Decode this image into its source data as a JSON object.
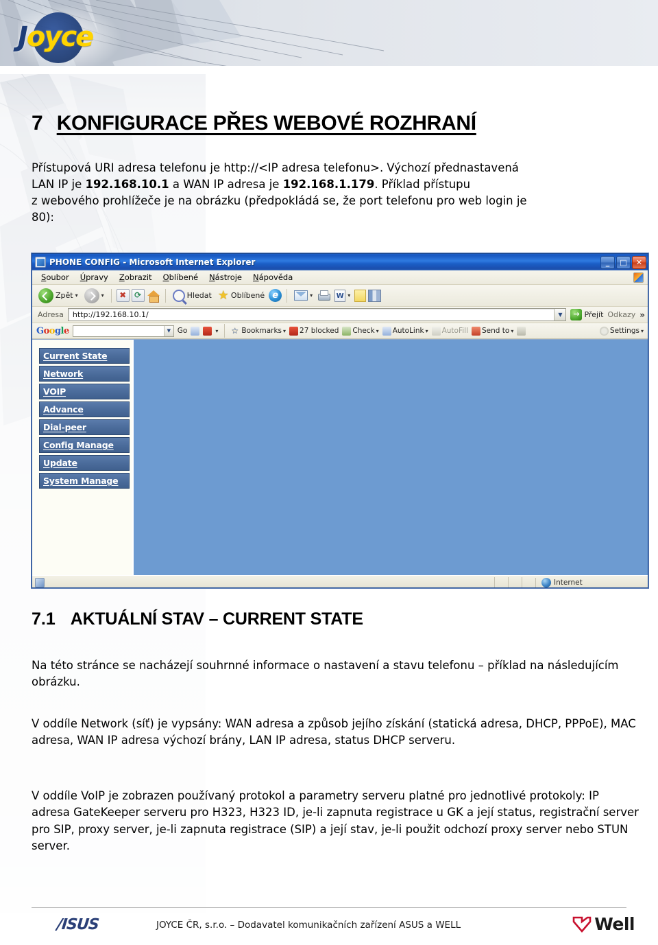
{
  "document": {
    "heading_number": "7",
    "heading_title": "KONFIGURACE PŘES WEBOVÉ ROZHRANÍ",
    "intro_line1": "Přístupová URI adresa telefonu je http://<IP adresa telefonu>. Výchozí přednastavená",
    "intro_line2_a": "LAN IP je ",
    "intro_lan_ip": "192.168.10.1",
    "intro_line2_b": " a WAN IP adresa je ",
    "intro_wan_ip": "192.168.1.179",
    "intro_line2_c": ". Příklad přístupu",
    "intro_line3": "z webového prohlížeče je na obrázku (předpokládá se, že port telefonu pro web login je",
    "intro_line4": "80):",
    "section_number": "7.1",
    "section_title": "AKTUÁLNÍ STAV – CURRENT STATE",
    "paragraph_1": "Na této stránce se nacházejí souhrnné informace o nastavení a stavu telefonu – příklad na následujícím obrázku.",
    "paragraph_2": "V oddíle Network (síť) je vypsány: WAN adresa a způsob jejího získání (statická adresa, DHCP, PPPoE), MAC adresa, WAN IP adresa výchozí brány, LAN IP adresa, status DHCP serveru.",
    "paragraph_3": "V oddíle VoIP je zobrazen používaný protokol a parametry serveru platné pro jednotlivé protokoly:  IP adresa GateKeeper serveru pro H323, H323 ID, je-li zapnuta registrace u GK a její status, registrační server pro SIP, proxy server, je-li zapnuta registrace (SIP) a její stav, je-li použit odchozí proxy server nebo STUN server."
  },
  "brand": {
    "logo_j": "J",
    "logo_rest": "oyce",
    "accent_blue": "#1d3c77",
    "accent_yellow": "#ffd400"
  },
  "browser": {
    "title": "PHONE CONFIG - Microsoft Internet Explorer",
    "window_buttons": {
      "minimize": "_",
      "maximize": "□",
      "close": "✕"
    },
    "menu": [
      {
        "pre": "S",
        "post": "oubor"
      },
      {
        "pre": "Ú",
        "post": "pravy"
      },
      {
        "pre": "Z",
        "post": "obrazit"
      },
      {
        "pre": "O",
        "post": "blíbené"
      },
      {
        "pre": "N",
        "post": "ástroje"
      },
      {
        "pre": "N",
        "post": "ápověda"
      }
    ],
    "toolbar": {
      "back_label": "Zpět",
      "search_label": "Hledat",
      "favorites_label": "Oblíbené"
    },
    "address": {
      "label": "Adresa",
      "url": "http://192.168.10.1/",
      "go_label": "Přejít",
      "links_label": "Odkazy",
      "chevron": "»"
    },
    "google_toolbar": {
      "brand": "Google",
      "search_value": "",
      "go": "Go",
      "bookmarks": "Bookmarks",
      "blocked": "27 blocked",
      "check": "Check",
      "autolink": "AutoLink",
      "autofill": "AutoFill",
      "sendto": "Send to",
      "settings": "Settings",
      "dropdown_caret": "▾"
    },
    "nav_menu": [
      {
        "label": "Current State"
      },
      {
        "label": "Network"
      },
      {
        "label": "VOIP"
      },
      {
        "label": "Advance"
      },
      {
        "label": "Dial-peer"
      },
      {
        "label": "Config Manage"
      },
      {
        "label": "Update"
      },
      {
        "label": "System Manage"
      }
    ],
    "statusbar": {
      "zone": "Internet"
    },
    "content_bg": "#6d9bd1",
    "nav_button_bg": "#4a6b9a"
  },
  "footer": {
    "asus_label": "/ISUS",
    "text": "JOYCE ČR, s.r.o. – Dodavatel komunikačních zařízení ASUS a WELL",
    "well_label": "Well"
  }
}
